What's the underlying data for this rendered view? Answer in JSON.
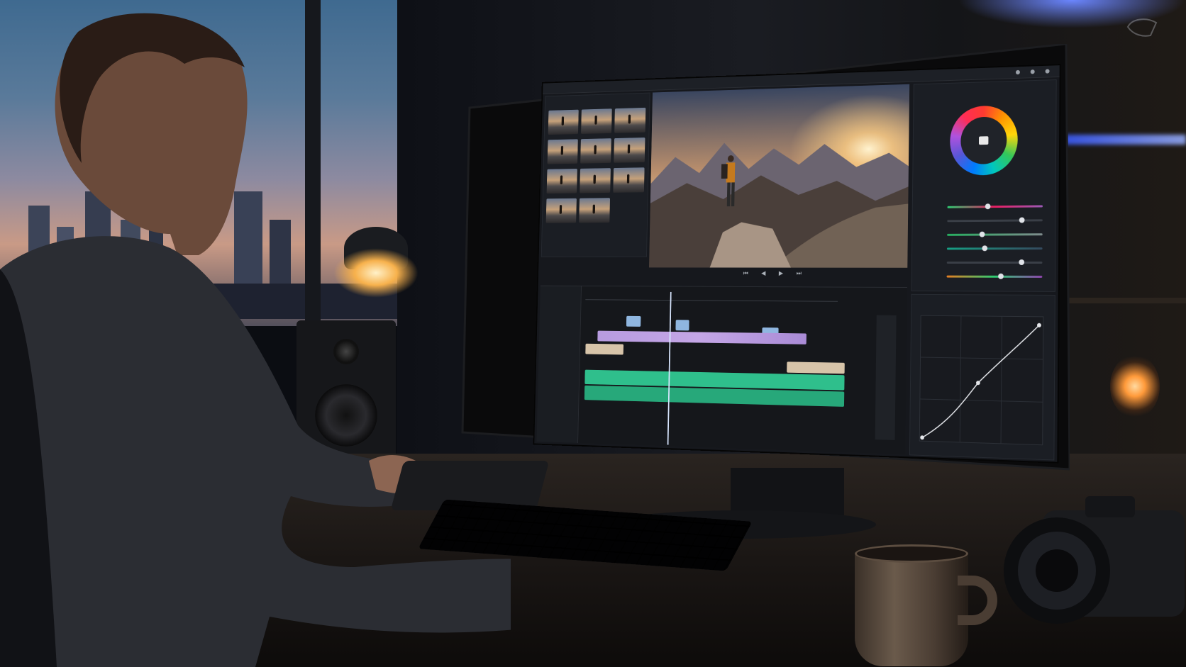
{
  "scene": {
    "description_icons": [
      "person-silhouette",
      "monitor",
      "keyboard",
      "mug",
      "camera",
      "speaker",
      "desk-lamp",
      "city-window"
    ]
  },
  "editor": {
    "app_title": "",
    "colors": {
      "wheel": [
        "#ff3b30",
        "#ffd60a",
        "#34c759",
        "#007aff",
        "#af52de"
      ],
      "timeline_video": "#a98bd6",
      "timeline_audio": "#2fbf8c",
      "playhead": "#d8e6ff",
      "panel_bg": "#1b1e24"
    }
  }
}
